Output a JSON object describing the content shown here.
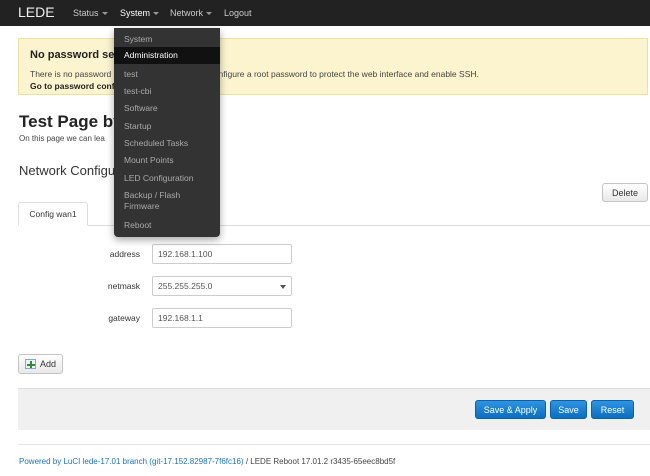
{
  "navbar": {
    "brand": "LEDE",
    "menus": [
      {
        "label": "Status"
      },
      {
        "label": "System"
      },
      {
        "label": "Network"
      },
      {
        "label": "Logout"
      }
    ]
  },
  "dropdown": {
    "items": [
      {
        "label": "System"
      },
      {
        "label": "Administration",
        "active": true
      },
      {
        "label": "test"
      },
      {
        "label": "test-cbi"
      },
      {
        "label": "Software"
      },
      {
        "label": "Startup"
      },
      {
        "label": "Scheduled Tasks"
      },
      {
        "label": "Mount Points"
      },
      {
        "label": "LED Configuration"
      },
      {
        "label": "Backup / Flash Firmware"
      },
      {
        "label": "Reboot"
      }
    ]
  },
  "alert": {
    "title": "No password set!",
    "text": "There is no password set on this router. Please configure a root password to protect the web interface and enable SSH.",
    "link": "Go to password configuration..."
  },
  "page": {
    "title": "Test Page by",
    "description": "On this page we can lea",
    "section_title": "Network Configu",
    "delete_label": "Delete",
    "tab_label": "Config wan1",
    "add_label": "Add"
  },
  "form": {
    "address": {
      "label": "address",
      "value": "192.168.1.100"
    },
    "netmask": {
      "label": "netmask",
      "value": "255.255.255.0"
    },
    "gateway": {
      "label": "gateway",
      "value": "192.168.1.1"
    }
  },
  "actions": {
    "save_apply": "Save & Apply",
    "save": "Save",
    "reset": "Reset"
  },
  "footer": {
    "link": "Powered by LuCI lede-17.01 branch (git-17.152.82987-7f6fc16)",
    "text": " / LEDE Reboot 17.01.2 r3435-65eec8bd5f"
  }
}
